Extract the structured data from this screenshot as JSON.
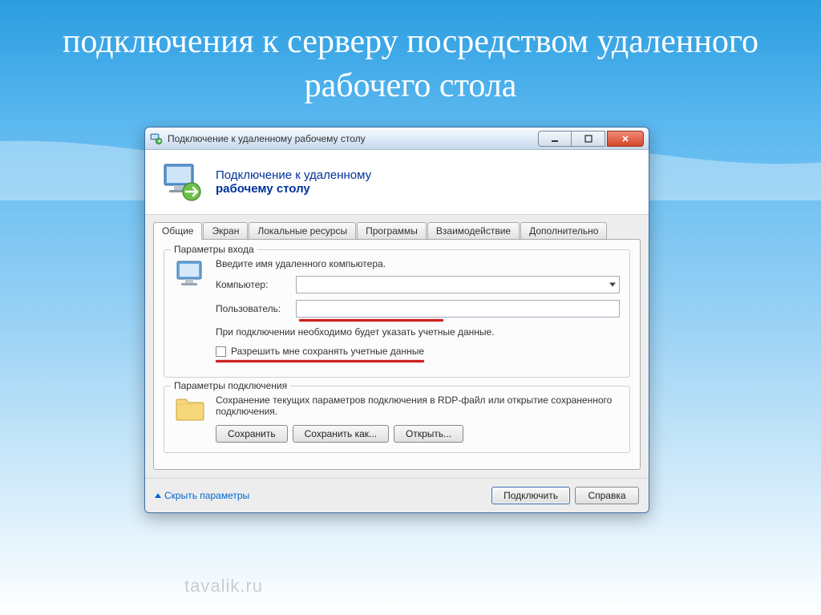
{
  "slide": {
    "title": "подключения к серверу посредством удаленного рабочего стола"
  },
  "window": {
    "title": "Подключение к удаленному рабочему столу",
    "banner": {
      "line1": "Подключение к удаленному",
      "line2": "рабочему столу"
    }
  },
  "tabs": {
    "general": "Общие",
    "screen": "Экран",
    "local_resources": "Локальные ресурсы",
    "programs": "Программы",
    "experience": "Взаимодействие",
    "advanced": "Дополнительно"
  },
  "login_group": {
    "title": "Параметры входа",
    "instruction": "Введите имя удаленного компьютера.",
    "computer_label": "Компьютер:",
    "user_label": "Пользователь:",
    "note": "При подключении необходимо будет указать учетные данные.",
    "allow_save_label": "Разрешить мне сохранять учетные данные"
  },
  "conn_group": {
    "title": "Параметры подключения",
    "description": "Сохранение текущих параметров подключения в RDP-файл или открытие сохраненного подключения.",
    "save_btn": "Сохранить",
    "save_as_btn": "Сохранить как...",
    "open_btn": "Открыть..."
  },
  "footer": {
    "toggle_link": "Скрыть параметры",
    "connect_btn": "Подключить",
    "help_btn": "Справка"
  },
  "watermark": "tavalik.ru"
}
